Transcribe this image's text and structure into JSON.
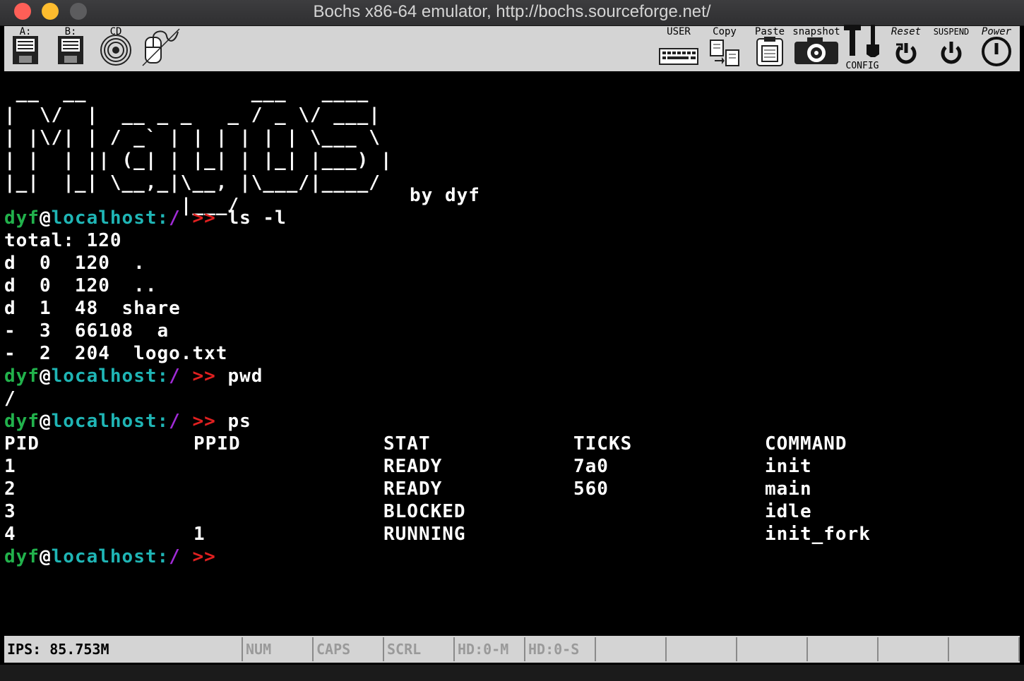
{
  "window": {
    "title": "Bochs x86-64 emulator, http://bochs.sourceforge.net/"
  },
  "toolbar": {
    "floppy_a_label": "A:",
    "floppy_b_label": "B:",
    "cdrom_label": "CD",
    "user_label": "USER",
    "copy_label": "Copy",
    "paste_label": "Paste",
    "snapshot_label": "snapshot",
    "config_label": "CONFIG",
    "reset_label": "Reset",
    "suspend_label": "SUSPEND",
    "power_label": "Power"
  },
  "terminal": {
    "logo_lines": [
      " __  __              ___   ____  ",
      "|  \\/  |  __ _ _   _ / _ \\/ ___| ",
      "| |\\/| | / _` | | | | | | \\___ \\ ",
      "| |  | || (_| | |_| | |_| |___) |",
      "|_|  |_| \\__,_|\\__, |\\___/|____/ ",
      "               |___/              "
    ],
    "byline": "by dyf",
    "prompt": {
      "user": "dyf",
      "at": "@",
      "host": "localhost",
      "colon": ":",
      "path": "/",
      "symbol": ">>"
    },
    "commands": [
      "ls -l",
      "pwd",
      "ps"
    ],
    "ls_output": [
      "total: 120",
      "d  0  120  .",
      "d  0  120  ..",
      "d  1  48  share",
      "-  3  66108  a",
      "-  2  204  logo.txt"
    ],
    "pwd_output": "/",
    "ps": {
      "headers": [
        "PID",
        "PPID",
        "STAT",
        "TICKS",
        "COMMAND"
      ],
      "rows": [
        [
          "1",
          "",
          "READY",
          "7a0",
          "init"
        ],
        [
          "2",
          "",
          "READY",
          "560",
          "main"
        ],
        [
          "3",
          "",
          "BLOCKED",
          "",
          "idle"
        ],
        [
          "4",
          "1",
          "RUNNING",
          "",
          "init_fork"
        ]
      ]
    }
  },
  "statusbar": {
    "ips": "IPS: 85.753M",
    "num": "NUM",
    "caps": "CAPS",
    "scrl": "SCRL",
    "hd0_master": "HD:0-M",
    "hd0_slave": "HD:0-S"
  },
  "colors": {
    "prompt_user": "#22b24c",
    "prompt_host": "#1fb5b5",
    "prompt_path": "#a02bd6",
    "prompt_symbol": "#e02020",
    "toolbar_bg": "#d4d4d4",
    "terminal_bg": "#000000"
  }
}
